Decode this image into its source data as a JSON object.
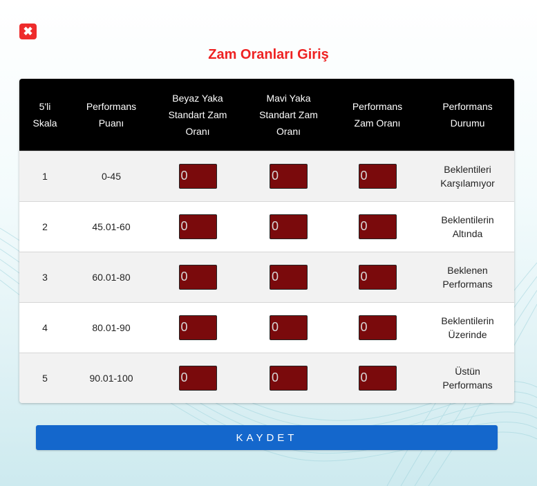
{
  "dialog": {
    "title": "Zam Oranları Giriş",
    "close_symbol": "✖",
    "close_icon": "close-icon",
    "save_label": "KAYDET"
  },
  "colors": {
    "title": "#ee2222",
    "close": "#ee2b2b",
    "header_bg": "#000000",
    "input_bg": "#7a0a0c",
    "save_button": "#1467cc"
  },
  "table": {
    "headers": [
      {
        "line1": "5'li",
        "line2": "Skala",
        "line3": ""
      },
      {
        "line1": "Performans",
        "line2": "Puanı",
        "line3": ""
      },
      {
        "line1": "Beyaz Yaka",
        "line2": "Standart Zam",
        "line3": "Oranı"
      },
      {
        "line1": "Mavi Yaka",
        "line2": "Standart Zam",
        "line3": "Oranı"
      },
      {
        "line1": "Performans",
        "line2": "Zam Oranı",
        "line3": ""
      },
      {
        "line1": "Performans",
        "line2": "Durumu",
        "line3": ""
      }
    ],
    "rows": [
      {
        "scale": "1",
        "score": "0-45",
        "white_collar": "0",
        "blue_collar": "0",
        "perf_rate": "0",
        "status1": "Beklentileri",
        "status2": "Karşılamıyor"
      },
      {
        "scale": "2",
        "score": "45.01-60",
        "white_collar": "0",
        "blue_collar": "0",
        "perf_rate": "0",
        "status1": "Beklentilerin",
        "status2": "Altında"
      },
      {
        "scale": "3",
        "score": "60.01-80",
        "white_collar": "0",
        "blue_collar": "0",
        "perf_rate": "0",
        "status1": "Beklenen",
        "status2": "Performans"
      },
      {
        "scale": "4",
        "score": "80.01-90",
        "white_collar": "0",
        "blue_collar": "0",
        "perf_rate": "0",
        "status1": "Beklentilerin",
        "status2": "Üzerinde"
      },
      {
        "scale": "5",
        "score": "90.01-100",
        "white_collar": "0",
        "blue_collar": "0",
        "perf_rate": "0",
        "status1": "Üstün",
        "status2": "Performans"
      }
    ]
  }
}
